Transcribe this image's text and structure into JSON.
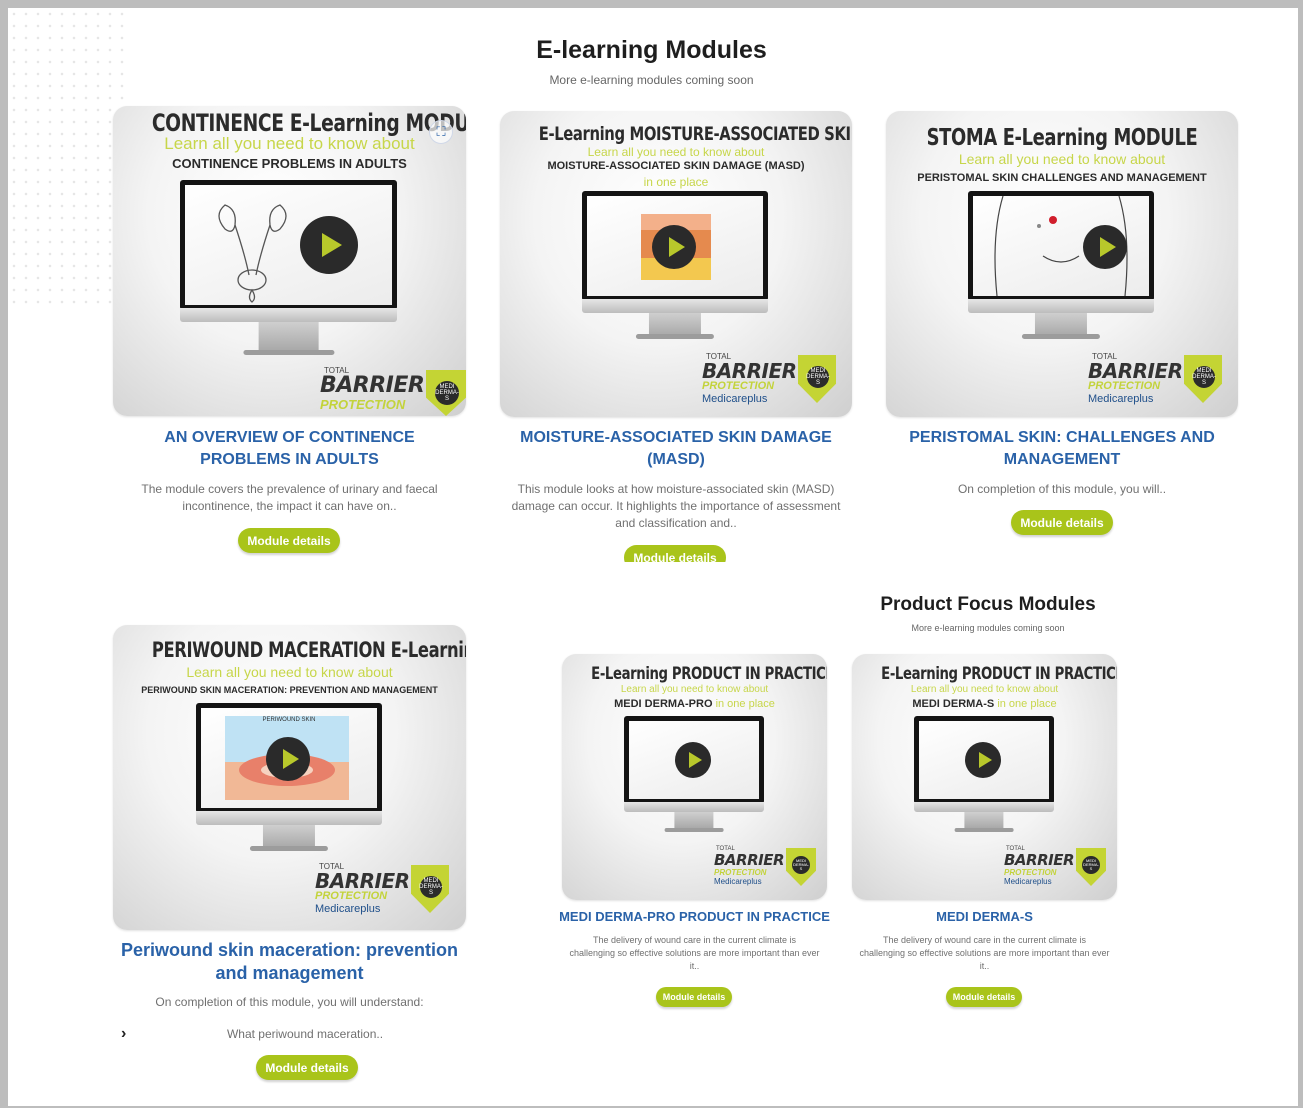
{
  "header": {
    "title": "E-learning Modules",
    "subtitle": "More e-learning modules coming soon"
  },
  "product_header": {
    "title": "Product Focus Modules",
    "subtitle": "More e-learning modules coming soon"
  },
  "logo": {
    "total": "TOTAL",
    "barrier": "BARRIER",
    "protection": "PROTECTION",
    "brand": "Medicareplus",
    "badge": "MEDI DERMA-S"
  },
  "modules": [
    {
      "thumb_title": "CONTINENCE E-Learning MODULE",
      "thumb_tagline": "Learn all you need to know about",
      "thumb_subject": "CONTINENCE PROBLEMS IN ADULTS",
      "title_line1": "AN OVERVIEW OF CONTINENCE",
      "title_line2": "PROBLEMS IN ADULTS",
      "desc_line1": "The module covers the prevalence of urinary and faecal",
      "desc_line2": "incontinence, the impact it can have on..",
      "button": "Module details"
    },
    {
      "thumb_title": "E-Learning MOISTURE-ASSOCIATED SKIN DAMAGE (MASD)",
      "thumb_tagline": "Learn all you need to know about",
      "thumb_subject": "MOISTURE-ASSOCIATED SKIN DAMAGE (MASD)",
      "thumb_tagline2": "in one place",
      "title_line1": "MOISTURE-ASSOCIATED SKIN DAMAGE",
      "title_line2": "(MASD)",
      "desc_line1": "This module looks at how moisture-associated skin (MASD)",
      "desc_line2": "damage can occur. It highlights the importance of assessment",
      "desc_line3": "and classification and..",
      "button": "Module details"
    },
    {
      "thumb_title": "STOMA E-Learning MODULE",
      "thumb_tagline": "Learn all you need to know about",
      "thumb_subject": "PERISTOMAL SKIN CHALLENGES AND MANAGEMENT",
      "title_line1": "PERISTOMAL SKIN: CHALLENGES AND",
      "title_line2": "MANAGEMENT",
      "desc_line1": "On completion of this module, you will..",
      "button": "Module details"
    },
    {
      "thumb_title": "PERIWOUND MACERATION E-Learning MODULE",
      "thumb_tagline": "Learn all you need to know about",
      "thumb_subject": "PERIWOUND SKIN MACERATION: PREVENTION AND MANAGEMENT",
      "screen_label": "PERIWOUND SKIN",
      "title_line1": "Periwound skin maceration: prevention",
      "title_line2": "and management",
      "desc_line1": "On completion of this module, you will understand:",
      "desc_line2": "What periwound maceration..",
      "button": "Module details"
    },
    {
      "thumb_title": "E-Learning PRODUCT IN PRACTICE MODULE",
      "thumb_tagline": "Learn all you need to know about",
      "thumb_subject": "MEDI DERMA-PRO",
      "thumb_tagline2": "in one place",
      "title_line1": "MEDI DERMA-PRO PRODUCT IN PRACTICE",
      "desc_line1": "The delivery of wound care in the current climate is",
      "desc_line2": "challenging so effective solutions are more important than ever",
      "desc_line3": "it..",
      "button": "Module details"
    },
    {
      "thumb_title": "E-Learning PRODUCT IN PRACTICE MODULE",
      "thumb_tagline": "Learn all you need to know about",
      "thumb_subject": "MEDI DERMA-S",
      "thumb_tagline2": "in one place",
      "title_line1": "MEDI DERMA-S",
      "desc_line1": "The delivery of wound care in the current climate is",
      "desc_line2": "challenging so effective solutions are more important than ever",
      "desc_line3": "it..",
      "button": "Module details"
    }
  ],
  "colors": {
    "accent_green": "#a9c41a",
    "title_blue": "#2a62a8",
    "tagline_green": "#c7d64a"
  },
  "icons": [
    "play-icon",
    "expand-icon",
    "chevron-right-icon",
    "shield-icon"
  ]
}
